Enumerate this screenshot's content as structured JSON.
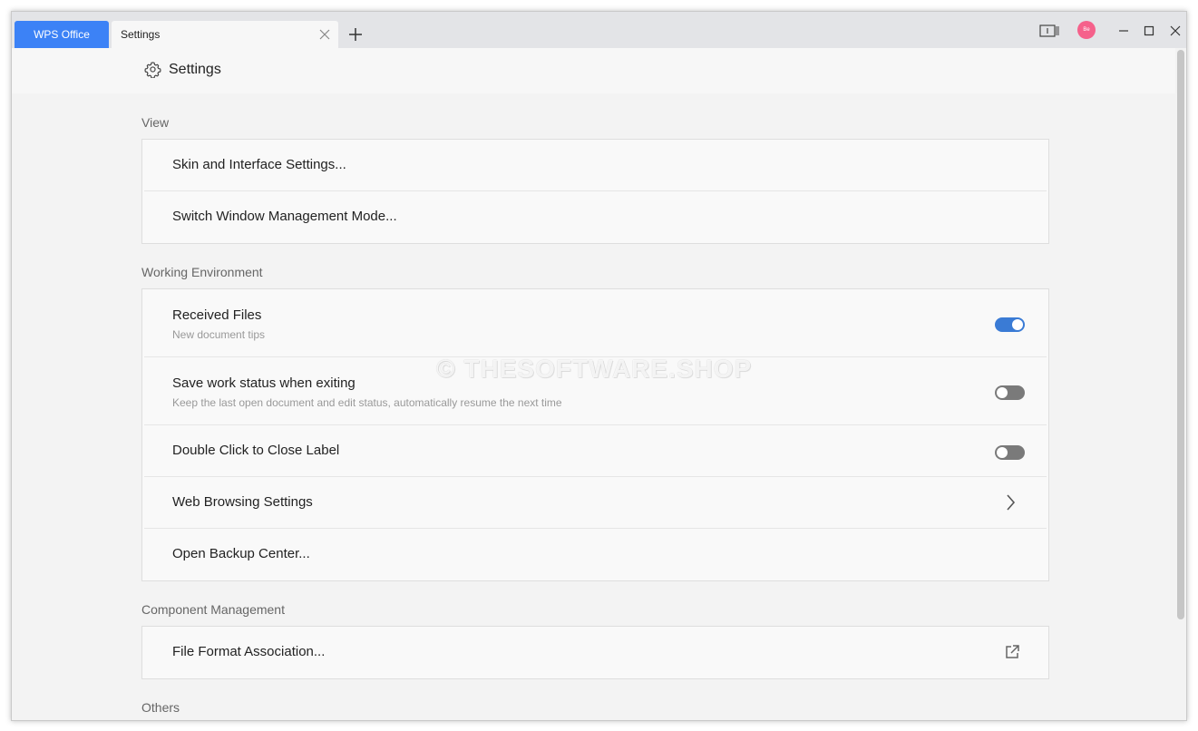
{
  "titlebar": {
    "tabs": [
      {
        "label": "WPS Office"
      },
      {
        "label": "Settings"
      }
    ],
    "avatar_text": "Be"
  },
  "header": {
    "title": "Settings"
  },
  "sections": {
    "view": {
      "label": "View",
      "items": [
        {
          "title": "Skin and Interface Settings..."
        },
        {
          "title": "Switch Window Management Mode..."
        }
      ]
    },
    "working": {
      "label": "Working Environment",
      "items": [
        {
          "title": "Received Files",
          "subtitle": "New document tips",
          "toggle": "on"
        },
        {
          "title": "Save work status when exiting",
          "subtitle": "Keep the last open document and edit status, automatically resume the next time",
          "toggle": "off"
        },
        {
          "title": "Double Click to Close Label",
          "toggle": "off"
        },
        {
          "title": "Web Browsing Settings",
          "icon": "chevron-right-icon"
        },
        {
          "title": "Open Backup Center..."
        }
      ]
    },
    "component": {
      "label": "Component Management",
      "items": [
        {
          "title": "File Format Association...",
          "icon": "external-link-icon"
        }
      ]
    },
    "others": {
      "label": "Others"
    }
  },
  "watermark": "© THESOFTWARE.SHOP",
  "colors": {
    "accent": "#3c82f6",
    "toggle_on": "#3a7bd5",
    "toggle_off": "#7a7a7a",
    "avatar": "#f5618b"
  }
}
